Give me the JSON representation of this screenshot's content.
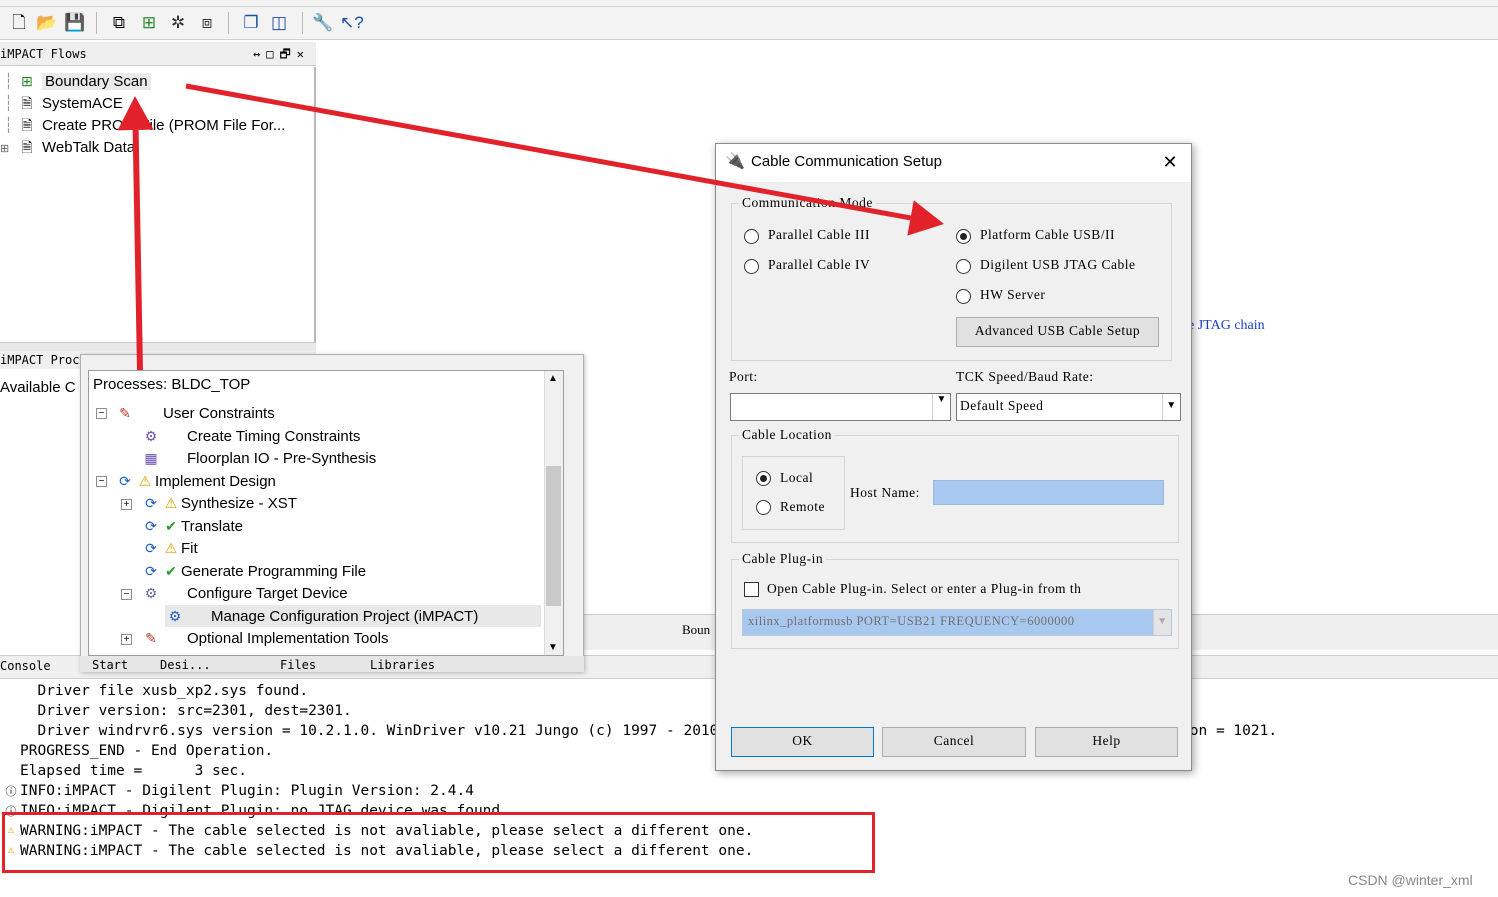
{
  "toolbar": {
    "icons": [
      "new-file-icon",
      "open-folder-icon",
      "save-icon",
      "copy-icon",
      "grid-icon",
      "chip-star-icon",
      "chip-icon",
      "window-cascade-icon",
      "window-tile-icon",
      "wrench-icon",
      "help-pointer-icon"
    ]
  },
  "flows": {
    "title": "iMPACT Flows",
    "items": [
      {
        "label": "Boundary Scan"
      },
      {
        "label": "SystemACE"
      },
      {
        "label": "Create PROM File (PROM File For..."
      },
      {
        "label": "WebTalk Data"
      }
    ]
  },
  "processes_panel": {
    "title": "iMPACT Proc",
    "available": "Available C"
  },
  "processes_window": {
    "header": "Processes: BLDC_TOP",
    "rows": [
      {
        "label": "User Constraints"
      },
      {
        "label": "Create Timing Constraints"
      },
      {
        "label": "Floorplan IO - Pre-Synthesis"
      },
      {
        "label": "Implement Design"
      },
      {
        "label": "Synthesize - XST"
      },
      {
        "label": "Translate"
      },
      {
        "label": "Fit"
      },
      {
        "label": "Generate Programming File"
      },
      {
        "label": "Configure Target Device"
      },
      {
        "label": "Manage Configuration Project (iMPACT)"
      },
      {
        "label": "Optional Implementation Tools"
      }
    ],
    "tabs": [
      "Start",
      "Desi...",
      "Files",
      "Libraries"
    ]
  },
  "main": {
    "jtag_link": "e JTAG chain",
    "boundary_tab": "Boun"
  },
  "console": {
    "title": "Console",
    "lines": [
      "  Driver file xusb_xp2.sys found.",
      "  Driver version: src=2301, dest=2301.",
      "  Driver windrvr6.sys version = 10.2.1.0. WinDriver v10.21 Jungo (c) 1997 - 2010 Build Date: Aug 31 2010 X86 32bit SYS 14:14:44, version = 1021.",
      "PROGRESS_END - End Operation.",
      "Elapsed time =      3 sec.",
      "INFO:iMPACT - Digilent Plugin: Plugin Version: 2.4.4",
      "INFO:iMPACT - Digilent Plugin: no JTAG device was found.",
      "WARNING:iMPACT - The cable selected is not avaliable, please select a different one.",
      "WARNING:iMPACT - The cable selected is not avaliable, please select a different one."
    ]
  },
  "dialog": {
    "title": "Cable Communication Setup",
    "comm_mode_label": "Communication Mode",
    "options_left": [
      "Parallel Cable III",
      "Parallel Cable IV"
    ],
    "options_right": [
      "Platform Cable USB/II",
      "Digilent USB JTAG Cable",
      "HW Server"
    ],
    "selected_mode": "Platform Cable USB/II",
    "advanced_button": "Advanced USB Cable Setup",
    "port_label": "Port:",
    "port_value": "",
    "tck_label": "TCK Speed/Baud Rate:",
    "tck_value": "Default Speed",
    "cable_location_label": "Cable Location",
    "location_local": "Local",
    "location_remote": "Remote",
    "host_name_label": "Host Name:",
    "plugin_label": "Cable Plug-in",
    "plugin_checkbox": "Open Cable Plug-in. Select or enter a Plug-in from th",
    "plugin_value": "xilinx_platformusb PORT=USB21 FREQUENCY=6000000",
    "ok": "OK",
    "cancel": "Cancel",
    "help": "Help"
  },
  "watermark": "CSDN @winter_xml",
  "colors": {
    "annotation_red": "#e2222a",
    "link_blue": "#1a3ec9",
    "host_field": "#a9c8ef"
  }
}
